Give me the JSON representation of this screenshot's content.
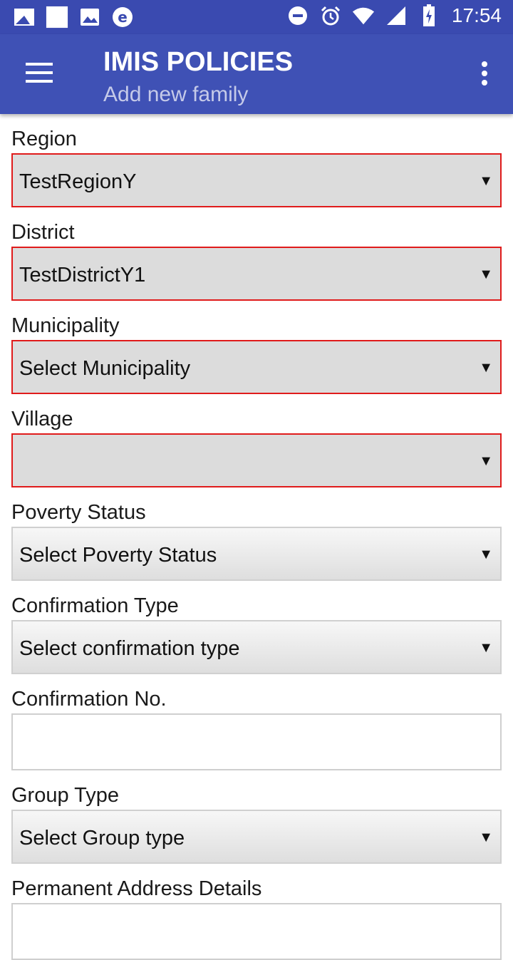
{
  "status_bar": {
    "time": "17:54",
    "left_icons": [
      "gallery-icon",
      "blank-icon",
      "image-icon",
      "e-icon"
    ],
    "right_icons": [
      "do-not-disturb-icon",
      "alarm-icon",
      "wifi-icon",
      "signal-icon",
      "battery-charging-icon"
    ]
  },
  "app_bar": {
    "title": "IMIS POLICIES",
    "subtitle": "Add new family",
    "color": "#3f51b5"
  },
  "form": {
    "region": {
      "label": "Region",
      "value": "TestRegionY"
    },
    "district": {
      "label": "District",
      "value": "TestDistrictY1"
    },
    "municipality": {
      "label": "Municipality",
      "value": "Select Municipality"
    },
    "village": {
      "label": "Village",
      "value": ""
    },
    "poverty_status": {
      "label": "Poverty Status",
      "value": "Select Poverty Status"
    },
    "confirmation_type": {
      "label": "Confirmation Type",
      "value": "Select confirmation type"
    },
    "confirmation_no": {
      "label": "Confirmation No.",
      "value": ""
    },
    "group_type": {
      "label": "Group Type",
      "value": "Select Group type"
    },
    "permanent_address": {
      "label": "Permanent Address Details",
      "value": ""
    }
  },
  "colors": {
    "error_border": "#e01b1b",
    "status_bar": "#3a4ab0"
  }
}
